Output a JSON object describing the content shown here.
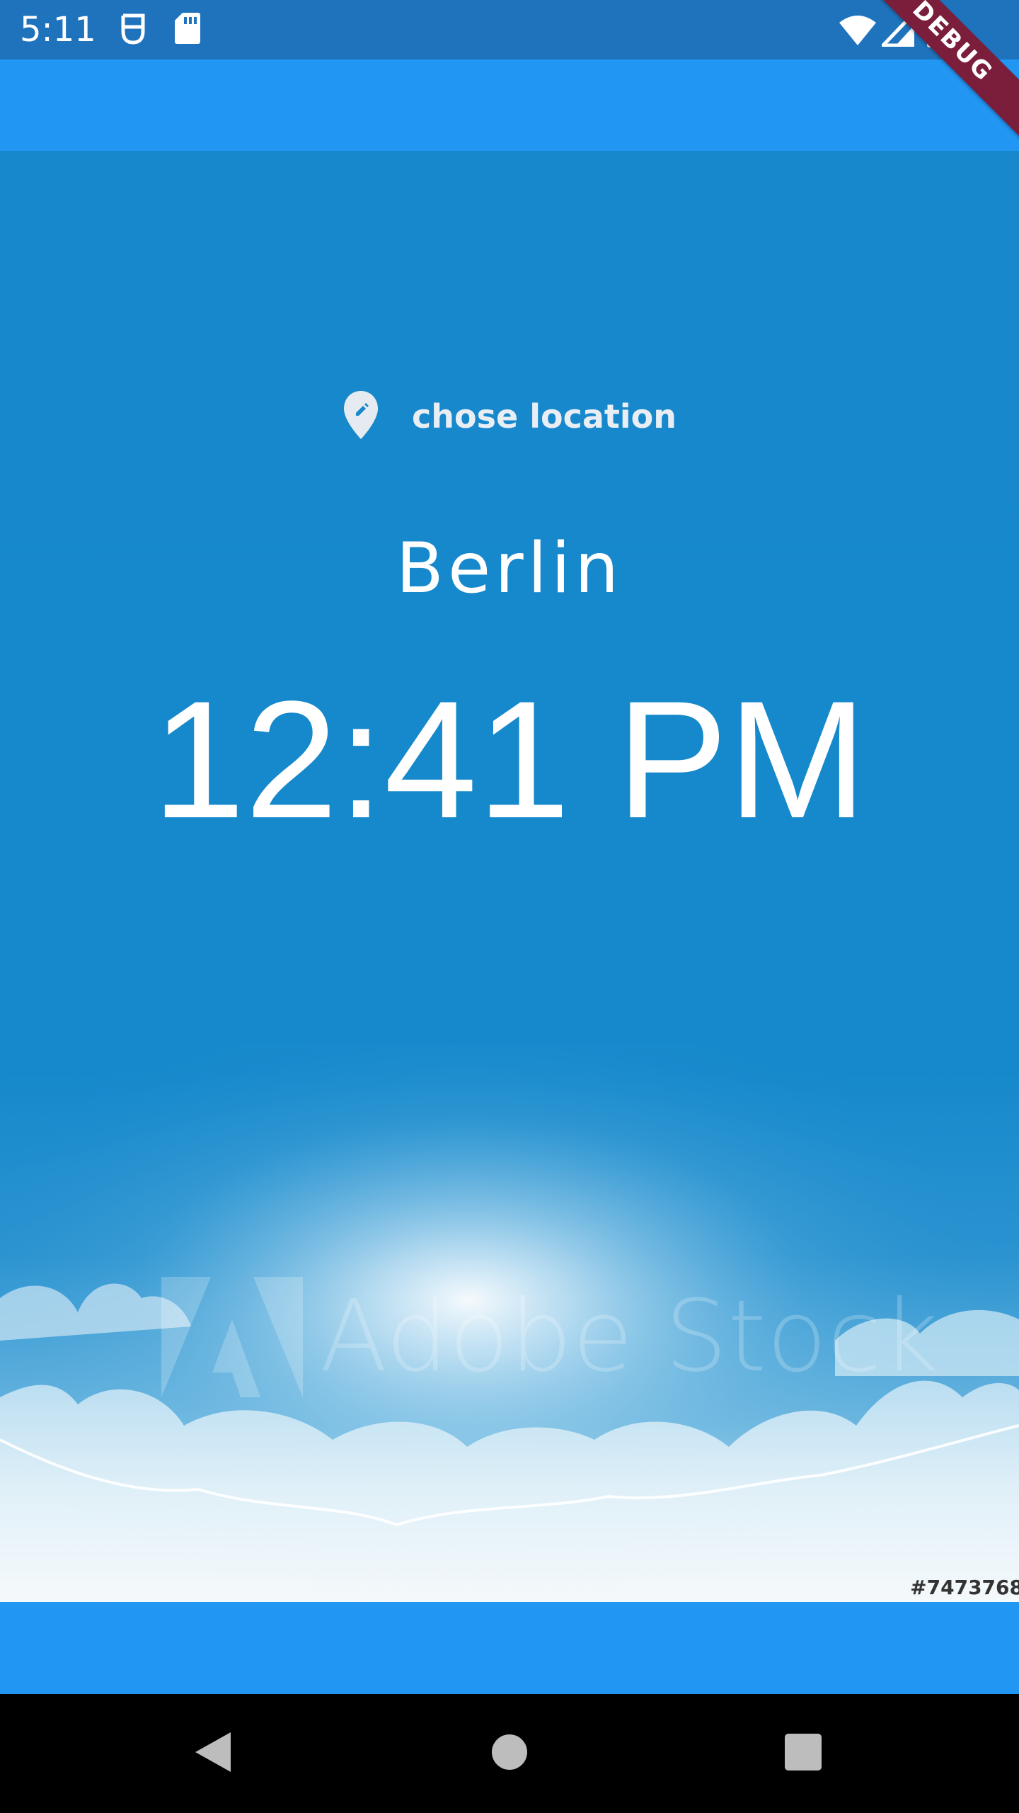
{
  "status_bar": {
    "time": "5:11",
    "icons": [
      "face-mask-icon",
      "sd-card-icon",
      "wifi-icon",
      "signal-icon",
      "battery-icon"
    ]
  },
  "debug_banner": "DEBUG",
  "location": {
    "icon": "edit-location-icon",
    "label": "chose location"
  },
  "city": "Berlin",
  "time": "12:41 PM",
  "background": {
    "watermark_text": "Adobe Stock",
    "stock_id": "#7473768"
  },
  "nav_bar": {
    "icons": [
      "back-icon",
      "home-icon",
      "recents-icon"
    ]
  },
  "colors": {
    "app_bar": "#2196f3",
    "status_bar": "#1f73bd",
    "main_bg": "#1788cb"
  }
}
